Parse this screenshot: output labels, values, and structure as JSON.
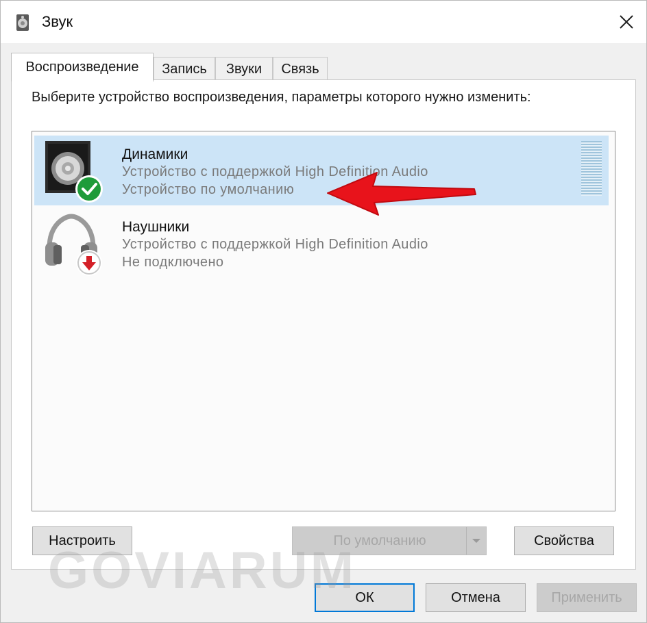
{
  "window": {
    "title": "Звук"
  },
  "tabs": [
    {
      "label": "Воспроизведение",
      "active": true
    },
    {
      "label": "Запись",
      "active": false
    },
    {
      "label": "Звуки",
      "active": false
    },
    {
      "label": "Связь",
      "active": false
    }
  ],
  "instruction": "Выберите устройство воспроизведения, параметры которого нужно изменить:",
  "devices": [
    {
      "name": "Динамики",
      "description": "Устройство с поддержкой High Definition Audio",
      "status": "Устройство по умолчанию",
      "icon": "speaker-icon",
      "badge": "check-badge-icon",
      "selected": true
    },
    {
      "name": "Наушники",
      "description": "Устройство с поддержкой High Definition Audio",
      "status": "Не подключено",
      "icon": "headphones-icon",
      "badge": "down-arrow-badge-icon",
      "selected": false
    }
  ],
  "buttons": {
    "configure": "Настроить",
    "set_default": "По умолчанию",
    "properties": "Свойства",
    "ok": "ОК",
    "cancel": "Отмена",
    "apply": "Применить"
  },
  "watermark": "GOVIARUM",
  "colors": {
    "selection": "#cce4f7",
    "accent": "#0078d7",
    "annotation_arrow": "#e8131b",
    "default_badge": "#1e9b3a",
    "unplugged_badge": "#d42027"
  }
}
